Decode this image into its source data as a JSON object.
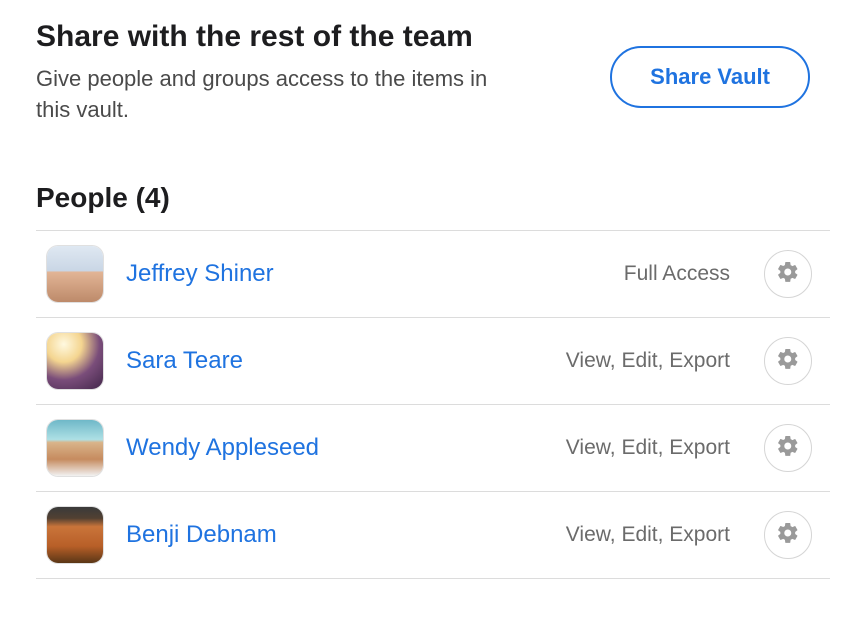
{
  "header": {
    "title": "Share with the rest of the team",
    "subtitle": "Give people and groups access to the items in this vault.",
    "share_button": "Share Vault"
  },
  "people": {
    "heading": "People (4)",
    "items": [
      {
        "name": "Jeffrey Shiner",
        "permission": "Full Access"
      },
      {
        "name": "Sara Teare",
        "permission": "View, Edit, Export"
      },
      {
        "name": "Wendy Appleseed",
        "permission": "View, Edit, Export"
      },
      {
        "name": "Benji Debnam",
        "permission": "View, Edit, Export"
      }
    ]
  }
}
